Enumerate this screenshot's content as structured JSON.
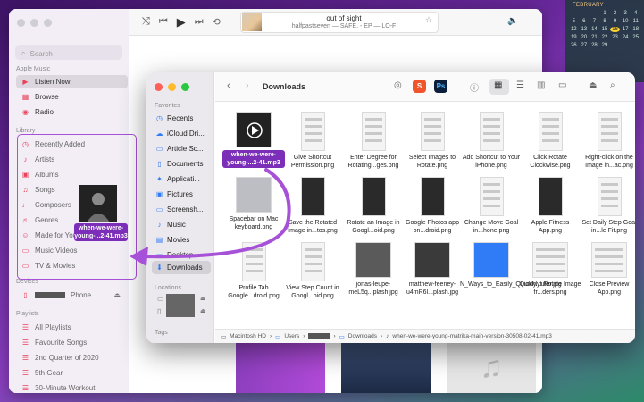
{
  "music": {
    "search_placeholder": "Search",
    "sections": {
      "apple_music": "Apple Music",
      "library": "Library",
      "devices": "Devices",
      "playlists": "Playlists"
    },
    "apple_music_items": [
      "Listen Now",
      "Browse",
      "Radio"
    ],
    "library_items": [
      "Recently Added",
      "Artists",
      "Albums",
      "Songs",
      "Composers",
      "Genres",
      "Made for You",
      "Music Videos",
      "TV & Movies"
    ],
    "device_label": "Phone",
    "playlist_items": [
      "All Playlists",
      "Favourite Songs",
      "2nd Quarter of 2020",
      "5th Gear",
      "30-Minute Workout"
    ],
    "now_playing": {
      "title": "out of sight",
      "subtitle": "halfpastseven — SAFE. - EP — LO-FI"
    }
  },
  "calendar": {
    "month": "FEBRUARY",
    "days": [
      "",
      "",
      "",
      "1",
      "2",
      "3",
      "4",
      "5",
      "6",
      "7",
      "8",
      "9",
      "10",
      "11",
      "12",
      "13",
      "14",
      "15",
      "16",
      "17",
      "18",
      "19",
      "20",
      "21",
      "22",
      "23",
      "24",
      "25",
      "26",
      "27",
      "28",
      "29"
    ],
    "today": "16"
  },
  "finder": {
    "title": "Downloads",
    "sections": {
      "favorites": "Favorites",
      "locations": "Locations",
      "tags": "Tags"
    },
    "sidebar": [
      "Recents",
      "iCloud Dri...",
      "Article Sc...",
      "Documents",
      "Applicati...",
      "Pictures",
      "Screensh...",
      "Music",
      "Movies",
      "Desktop",
      "Downloads"
    ],
    "files": [
      [
        "when-we-were-young-...2-41.mp3",
        "Give Shortcut Permission.png",
        "Enter Degree for Rotating...ges.png",
        "Select Images to Rotate.png",
        "Add Shortcut to Your iPhone.png",
        "Click Rotate Clockwise.png",
        "Right-click on the Image in...ac.png"
      ],
      [
        "Spacebar on Mac keyboard.png",
        "Save the Rotated Image in...tos.png",
        "Rotate an Image in Googl...oid.png",
        "Google Photos app on...droid.png",
        "Change Move Goal in...hone.png",
        "Apple Fitness App.png",
        "Set Daily Step Goal in...le Fit.png"
      ],
      [
        "Profile Tab Google...droid.png",
        "View Step Count in Googl...oid.png",
        "jonas-leupe-meL5q...plash.jpg",
        "matthew-feeney-u4mR6l...plash.jpg",
        "N_Ways_to_Easily_Quickly...uter.jpg",
        "Quicklyt Rotate Image fr...ders.png",
        "Close Preview App.png"
      ]
    ],
    "path": [
      "Macintosh HD",
      "Users",
      "Downloads",
      "when-we-were-young-matrika-main-version-30508-02-41.mp3"
    ]
  },
  "drag_label": "when-we-were-young-...2-41.mp3",
  "colors": {
    "accent": "#7b2fb8",
    "arrow": "#a651d8",
    "music_red": "#e8435a",
    "finder_blue": "#2f7cf6"
  }
}
